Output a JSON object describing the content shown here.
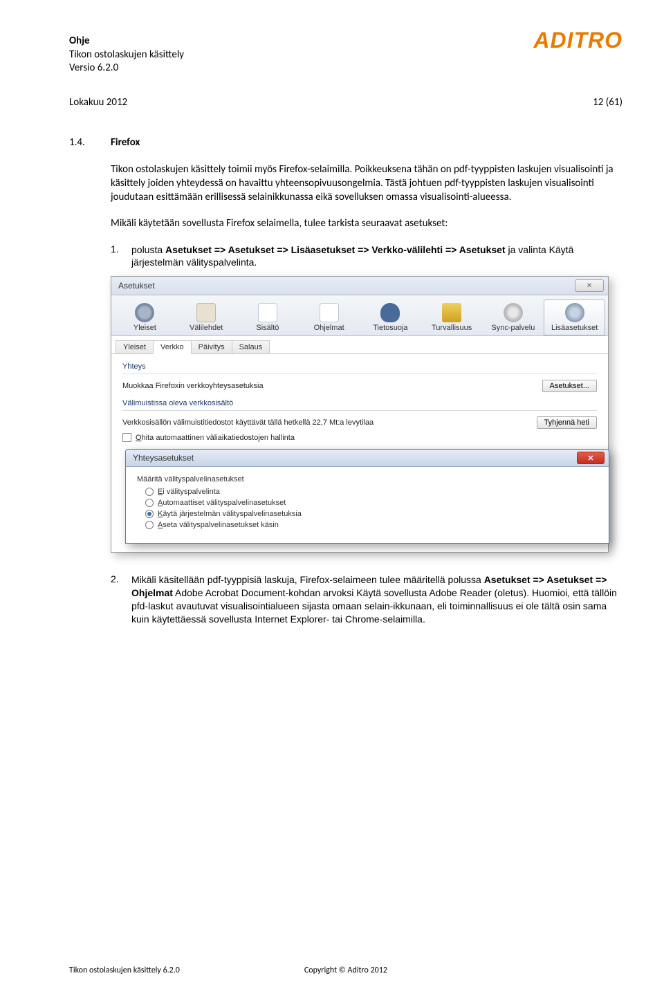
{
  "header": {
    "title": "Ohje",
    "subtitle": "Tikon ostolaskujen käsittely",
    "version": "Versio 6.2.0",
    "logo": "ADITRO",
    "date": "Lokakuu 2012",
    "page": "12 (61)"
  },
  "section": {
    "num": "1.4.",
    "title": "Firefox"
  },
  "para1": "Tikon ostolaskujen käsittely toimii myös Firefox-selaimilla. Poikkeuksena tähän on pdf-tyyppisten laskujen visualisointi ja käsittely joiden yhteydessä on havaittu yhteensopivuusongelmia. Tästä johtuen pdf-tyyppisten laskujen visualisointi joudutaan esittämään erillisessä selainikkunassa eikä sovelluksen omassa visualisointi-alueessa.",
  "para2": "Mikäli käytetään sovellusta Firefox selaimella, tulee tarkista seuraavat asetukset:",
  "item1": {
    "num": "1.",
    "text_before": "polusta ",
    "bold": "Asetukset => Asetukset => Lisäasetukset => Verkko-välilehti => Asetukset",
    "text_after": " ja valinta Käytä järjestelmän välityspalvelinta."
  },
  "item2": {
    "num": "2.",
    "t1": "Mikäli käsitellään pdf-tyyppisiä laskuja, Firefox-selaimeen tulee määritellä polussa ",
    "b1": "Asetukset => Asetukset => Ohjelmat",
    "t2": "  Adobe Acrobat Document-kohdan arvoksi Käytä sovellusta Adobe Reader (oletus). Huomioi, että tällöin pfd-laskut avautuvat visualisointialueen sijasta omaan selain-ikkunaan, eli toiminnallisuus ei ole tältä osin sama kuin käytettäessä sovellusta Internet Explorer- tai Chrome-selaimilla."
  },
  "dialog1": {
    "title": "Asetukset",
    "categories": [
      {
        "label": "Yleiset",
        "icon": "icon-gear"
      },
      {
        "label": "Välilehdet",
        "icon": "icon-folder"
      },
      {
        "label": "Sisältö",
        "icon": "icon-doc"
      },
      {
        "label": "Ohjelmat",
        "icon": "icon-cal"
      },
      {
        "label": "Tietosuoja",
        "icon": "icon-mask"
      },
      {
        "label": "Turvallisuus",
        "icon": "icon-lock"
      },
      {
        "label": "Sync-palvelu",
        "icon": "icon-sync"
      },
      {
        "label": "Lisäasetukset",
        "icon": "icon-adv"
      }
    ],
    "active_category": 7,
    "subtabs": [
      "Yleiset",
      "Verkko",
      "Päivitys",
      "Salaus"
    ],
    "active_subtab": 1,
    "group_yhteys": "Yhteys",
    "conn_text": "Muokkaa Firefoxin verkkoyhteysasetuksia",
    "conn_btn": "Asetukset...",
    "group_cache": "Välimuistissa oleva verkkosisältö",
    "cache_text": "Verkkosisällön välimuistitiedostot käyttävät tällä hetkellä 22,7 Mt:a levytilaa",
    "cache_btn": "Tyhjennä heti",
    "cache_check": "Ohita automaattinen väliaikatiedostojen hallinta"
  },
  "dialog2": {
    "title": "Yhteysasetukset",
    "heading": "Määritä välityspalvelinasetukset",
    "radios": [
      {
        "label": "Ei välityspalvelinta",
        "checked": false,
        "ul": "E"
      },
      {
        "label": "Automaattiset välityspalvelinasetukset",
        "checked": false,
        "ul": "A"
      },
      {
        "label": "Käytä järjestelmän välityspalvelinasetuksia",
        "checked": true,
        "ul": "K"
      },
      {
        "label": "Aseta välityspalvelinasetukset käsin",
        "checked": false,
        "ul": "A"
      }
    ]
  },
  "footer": {
    "left": "Tikon ostolaskujen käsittely 6.2.0",
    "right": "Copyright © Aditro 2012"
  }
}
